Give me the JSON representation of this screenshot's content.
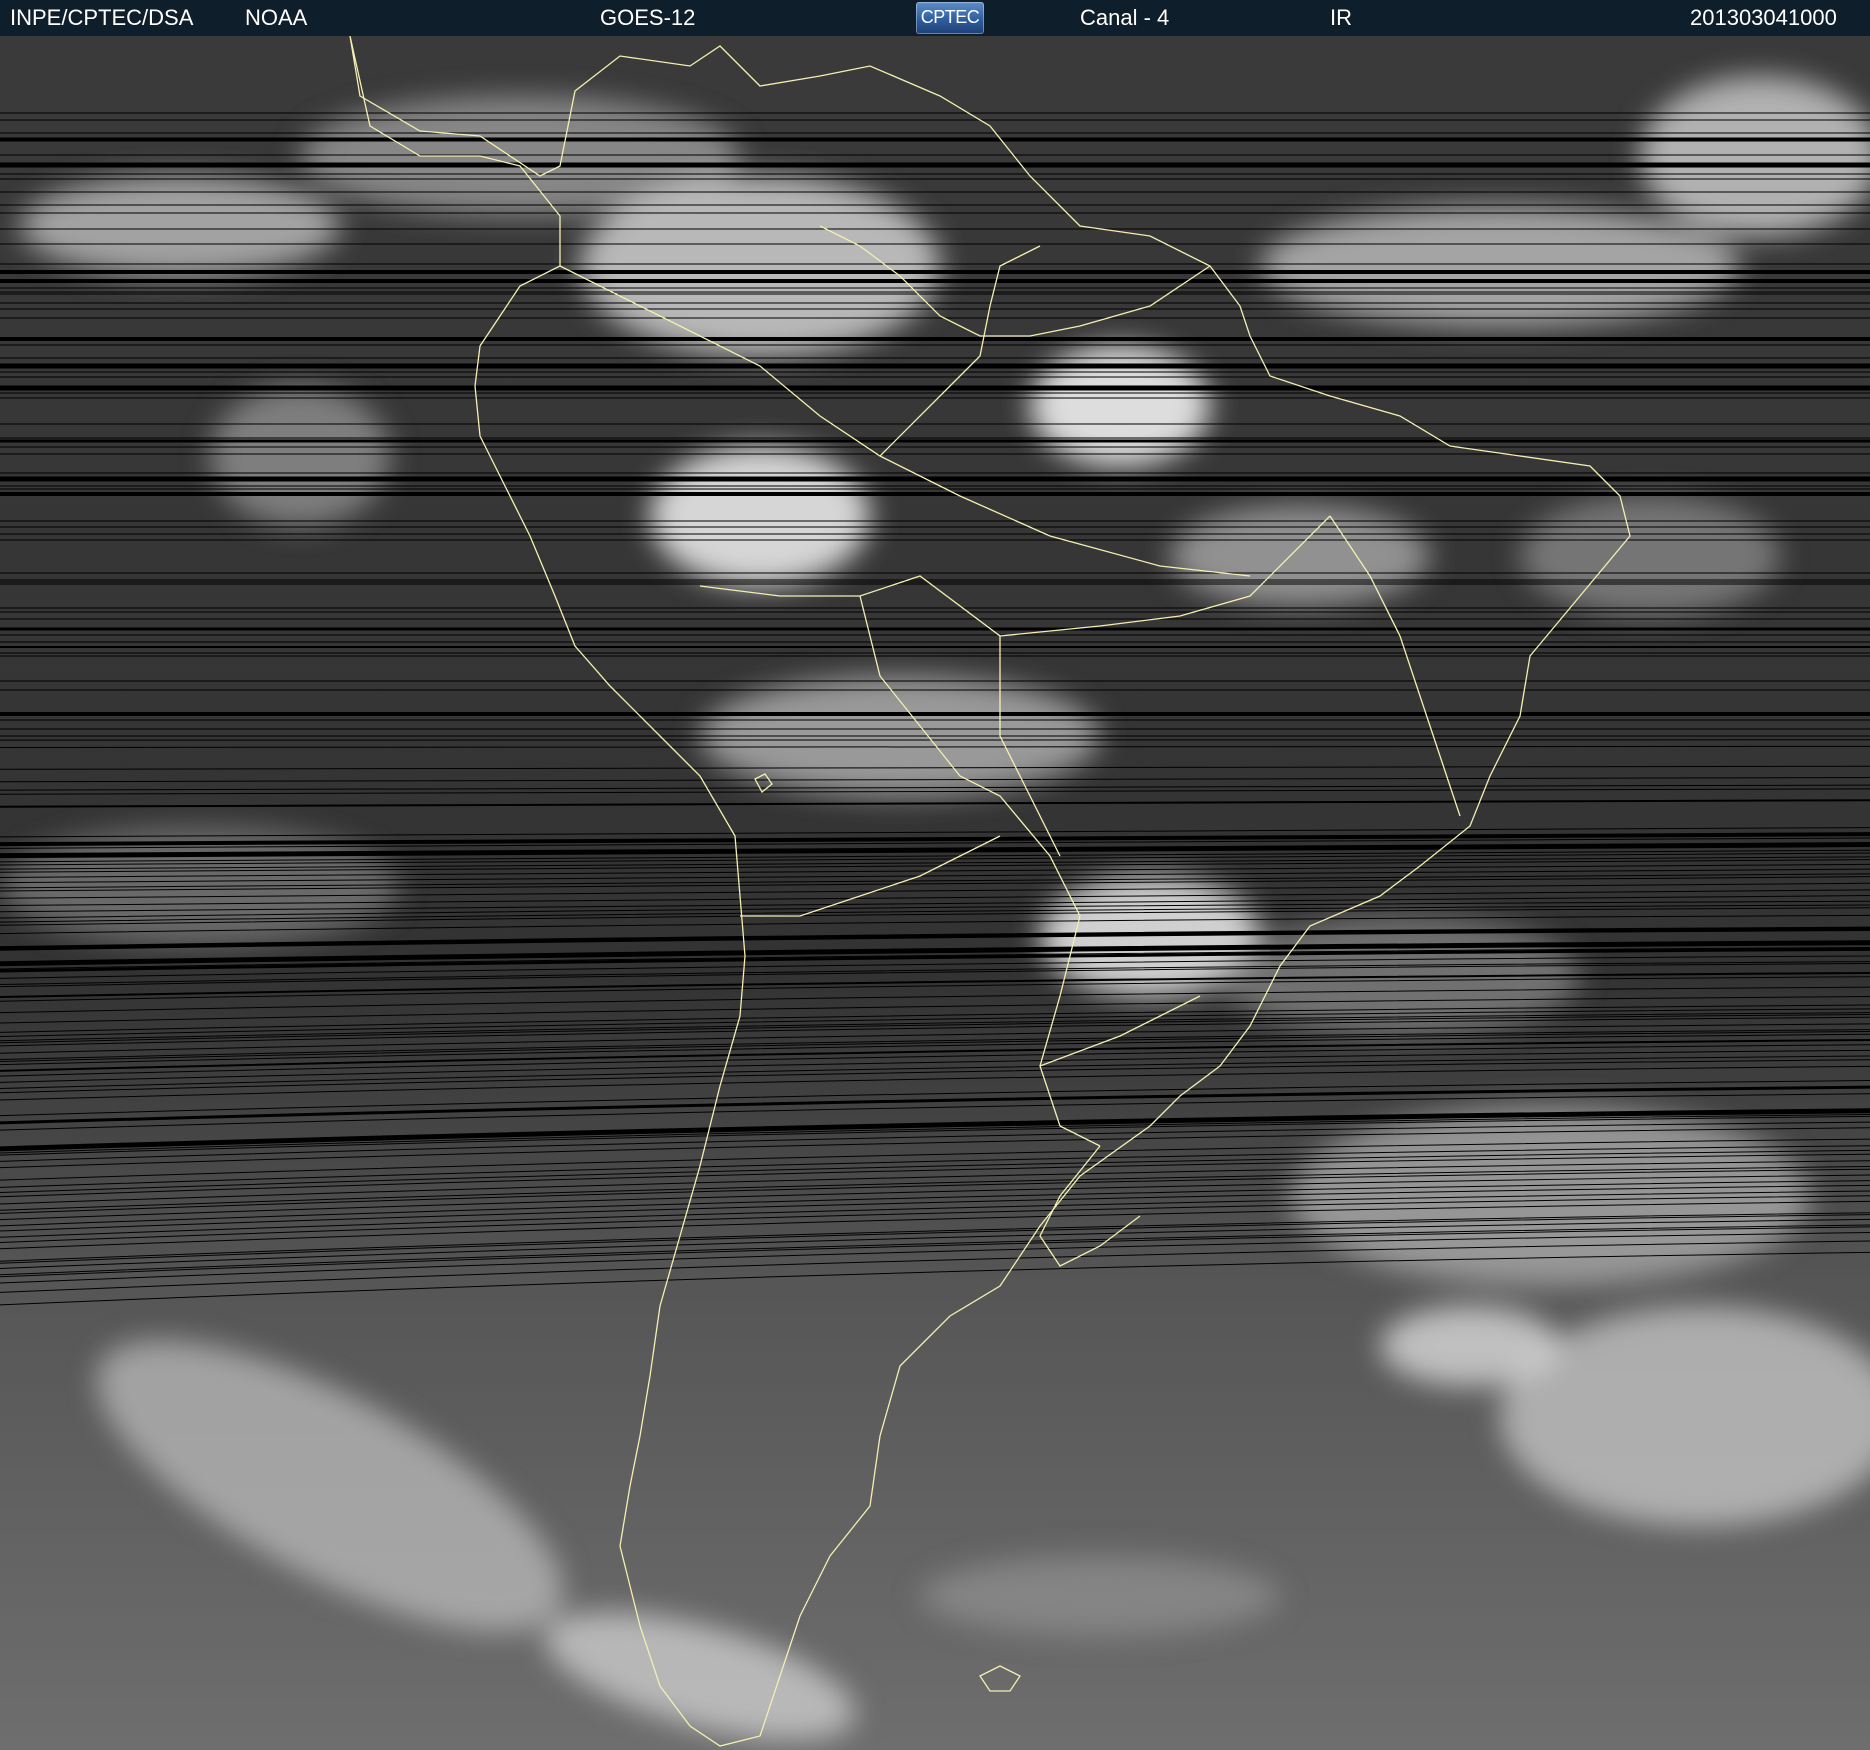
{
  "header": {
    "source": "INPE/CPTEC/DSA",
    "agency": "NOAA",
    "satellite": "GOES-12",
    "logo_text": "CPTEC",
    "channel": "Canal - 4",
    "band": "IR",
    "timestamp": "201303041000"
  },
  "colors": {
    "header_background": "#0f1e2b",
    "header_text": "#ffffff",
    "coastline": "#f2f0b0",
    "scan_gap": "#000000"
  },
  "icons": {
    "logo": "cptec-logo-icon"
  }
}
